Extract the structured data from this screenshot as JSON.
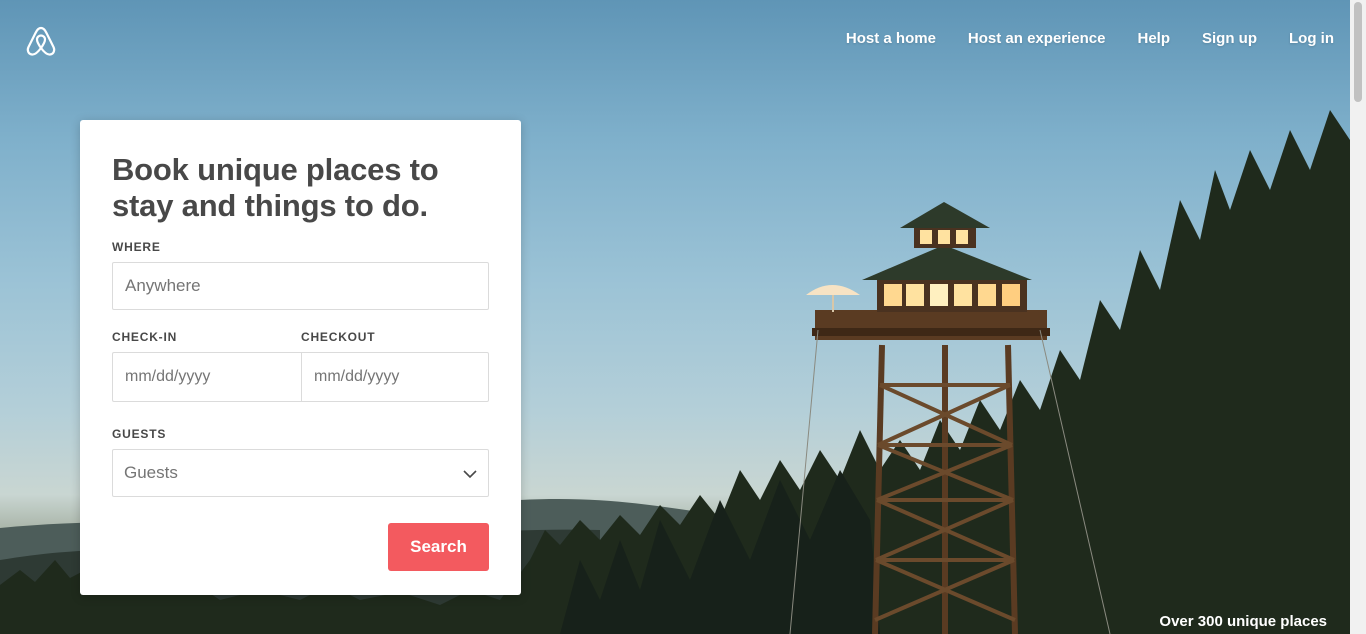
{
  "nav": {
    "items": [
      "Host a home",
      "Host an experience",
      "Help",
      "Sign up",
      "Log in"
    ]
  },
  "logo": {
    "icon": "airbnb-belo-icon"
  },
  "search_card": {
    "heading": "Book unique places to stay and things to do.",
    "where": {
      "label": "WHERE",
      "placeholder": "Anywhere"
    },
    "checkin": {
      "label": "CHECK-IN",
      "placeholder": "mm/dd/yyyy"
    },
    "checkout": {
      "label": "CHECKOUT",
      "placeholder": "mm/dd/yyyy"
    },
    "guests": {
      "label": "GUESTS",
      "value": "Guests"
    },
    "search_button": "Search"
  },
  "hero": {
    "caption": "Over 300 unique places"
  },
  "colors": {
    "brand": "#f35a5f",
    "text": "#484848",
    "border": "#dbdbdb"
  }
}
